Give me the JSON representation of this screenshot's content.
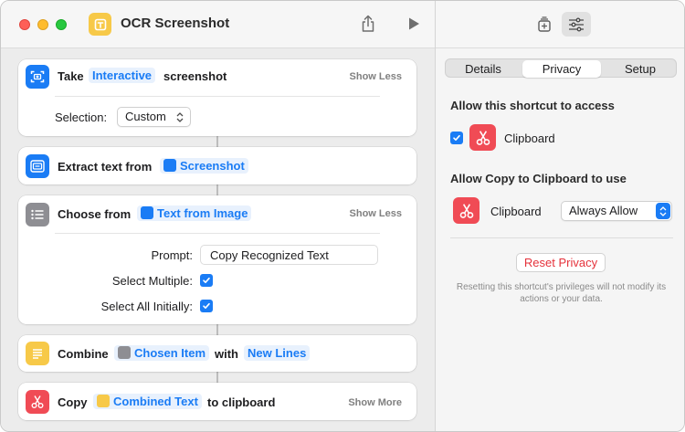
{
  "window": {
    "title": "OCR Screenshot"
  },
  "actions": {
    "take": {
      "verb": "Take",
      "mode": "Interactive",
      "object": "screenshot",
      "toggle": "Show Less",
      "selection_label": "Selection:",
      "selection_value": "Custom"
    },
    "extract": {
      "verb": "Extract text from",
      "source": "Screenshot"
    },
    "choose": {
      "verb": "Choose from",
      "source": "Text from Image",
      "toggle": "Show Less",
      "prompt_label": "Prompt:",
      "prompt_value": "Copy Recognized Text",
      "multiple_label": "Select Multiple:",
      "multiple_checked": true,
      "all_initially_label": "Select All Initially:",
      "all_initially_checked": true
    },
    "combine": {
      "verb": "Combine",
      "source": "Chosen Item",
      "with_label": "with",
      "separator": "New Lines"
    },
    "copy": {
      "verb": "Copy",
      "source": "Combined Text",
      "target": "to clipboard",
      "toggle": "Show More"
    }
  },
  "inspector": {
    "tabs": [
      "Details",
      "Privacy",
      "Setup"
    ],
    "selected_tab": "Privacy",
    "access_heading": "Allow this shortcut to access",
    "access_item": "Clipboard",
    "access_checked": true,
    "copy_heading": "Allow Copy to Clipboard to use",
    "copy_item": "Clipboard",
    "copy_permission": "Always Allow",
    "reset_button": "Reset Privacy",
    "reset_note": "Resetting this shortcut's privileges will not modify its actions or your data."
  },
  "colors": {
    "accent": "#1a7cf5",
    "clipboard_icon": "#f04b55",
    "shortcut_icon": "#f7c948",
    "reset_text": "#e5323b"
  }
}
